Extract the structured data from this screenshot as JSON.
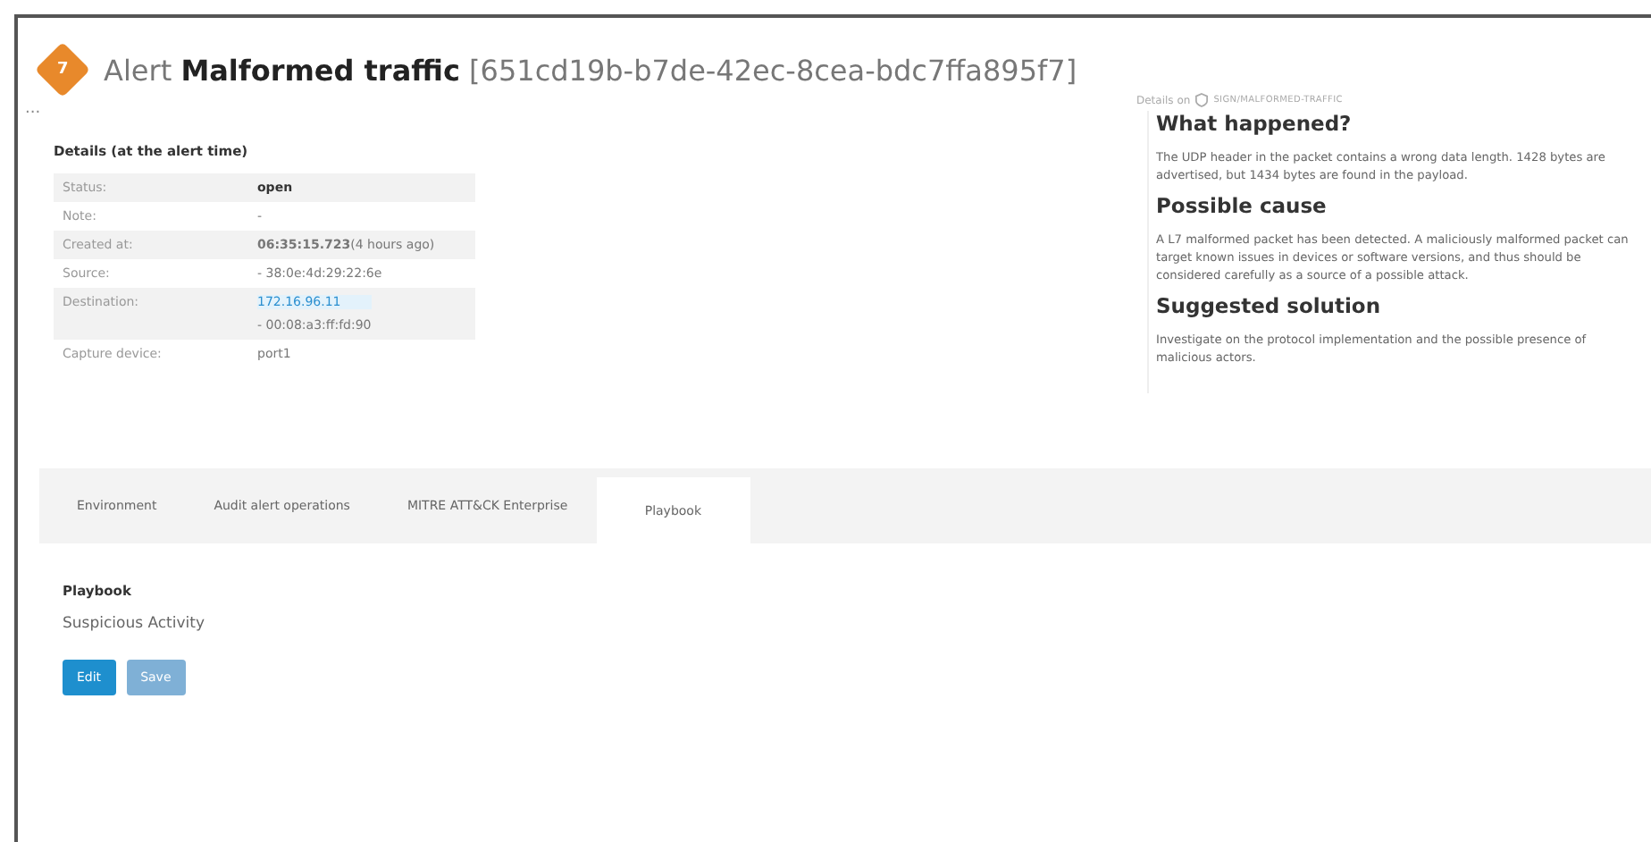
{
  "header": {
    "badge": "7",
    "prefix": "Alert",
    "title": "Malformed traffic",
    "id": "[651cd19b-b7de-42ec-8cea-bdc7ffa895f7]"
  },
  "more": "...",
  "details": {
    "title": "Details (at the alert time)",
    "rows": [
      {
        "label": "Status:",
        "lines": [
          {
            "kind": "strong",
            "text": "open"
          }
        ]
      },
      {
        "label": "Note:",
        "lines": [
          {
            "kind": "plain",
            "text": "-"
          }
        ]
      },
      {
        "label": "Created at:",
        "lines": [
          {
            "kind": "plain",
            "text": "**06:35:15.723**(4 hours ago)"
          }
        ]
      },
      {
        "label": "Source:",
        "lines": [
          {
            "kind": "plain",
            "text": "- 38:0e:4d:29:22:6e"
          }
        ]
      },
      {
        "label": "Destination:",
        "lines": [
          {
            "kind": "link",
            "text": "172.16.96.11"
          },
          {
            "kind": "plain",
            "text": "- 00:08:a3:ff:fd:90"
          }
        ]
      },
      {
        "label": "Capture device:",
        "lines": [
          {
            "kind": "plain",
            "text": "port1"
          }
        ]
      }
    ]
  },
  "info": {
    "caption": "Details on",
    "signature": "SIGN/MALFORMED-TRAFFIC",
    "sections": [
      {
        "heading": "What happened?",
        "body": "The UDP header in the packet contains a wrong data length. 1428 bytes are advertised, but 1434 bytes are found in the payload."
      },
      {
        "heading": "Possible cause",
        "body": "A L7 malformed packet has been detected. A maliciously malformed packet can target known issues in devices or software versions, and thus should be considered carefully as a source of a possible attack."
      },
      {
        "heading": "Suggested solution",
        "body": "Investigate on the protocol implementation and the possible presence of malicious actors."
      }
    ]
  },
  "tabs": [
    {
      "label": "Environment",
      "selected": false
    },
    {
      "label": "Audit alert operations",
      "selected": false
    },
    {
      "label": "MITRE ATT&CK Enterprise",
      "selected": false
    },
    {
      "label": "Playbook",
      "selected": true
    }
  ],
  "playbook": {
    "title": "Playbook",
    "value": "Suspicious Activity",
    "buttons": [
      {
        "label": "Edit",
        "disabled": false
      },
      {
        "label": "Save",
        "disabled": true
      }
    ]
  }
}
